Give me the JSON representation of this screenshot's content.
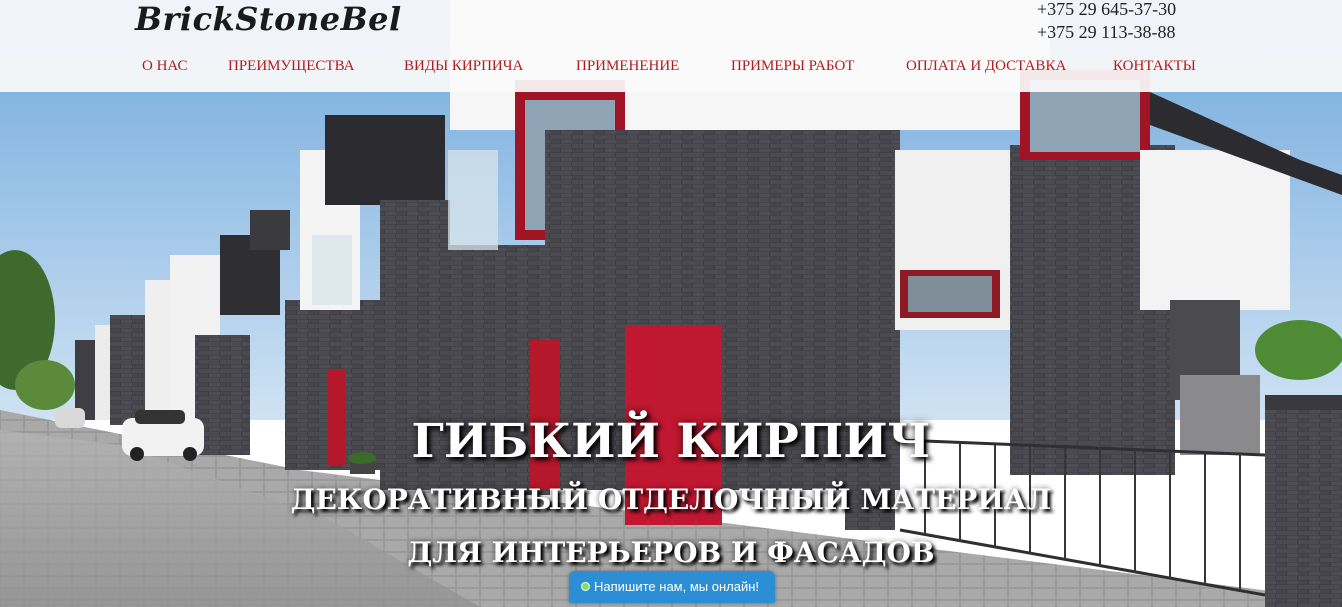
{
  "brand": {
    "logo": "BrickStoneBel"
  },
  "contacts": {
    "phones": [
      "+375 29 645-37-30",
      "+375 29 113-38-88"
    ]
  },
  "nav": {
    "items": [
      {
        "label": "О НАС"
      },
      {
        "label": "ПРЕИМУЩЕСТВА"
      },
      {
        "label": "ВИДЫ КИРПИЧА"
      },
      {
        "label": "ПРИМЕНЕНИЕ"
      },
      {
        "label": "ПРИМЕРЫ РАБОТ"
      },
      {
        "label": "ОПЛАТА И ДОСТАВКА"
      },
      {
        "label": "КОНТАКТЫ"
      }
    ]
  },
  "hero": {
    "title": "ГИБКИЙ КИРПИЧ",
    "subtitle_line1": "ДЕКОРАТИВНЫЙ ОТДЕЛОЧНЫЙ МАТЕРИАЛ",
    "subtitle_line2": "ДЛЯ ИНТЕРЬЕРОВ И ФАСАДОВ"
  },
  "chat": {
    "label": "Напишите нам, мы онлайн!",
    "status_color": "#7fe25a"
  },
  "colors": {
    "nav_accent": "#b11c1c",
    "chat_bg": "#2c8fd6"
  }
}
